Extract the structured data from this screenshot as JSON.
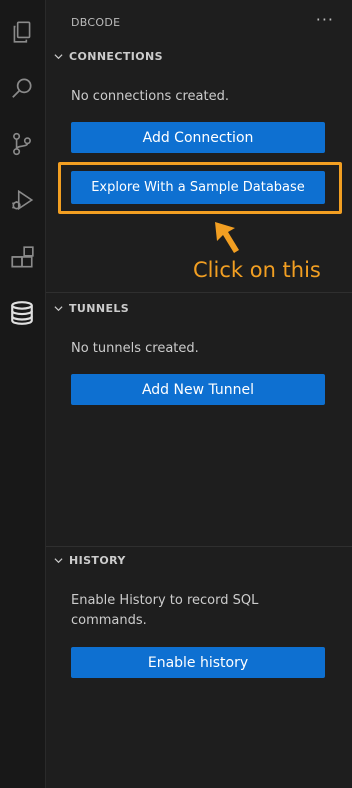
{
  "activity_bar": {
    "icons": [
      "explorer-icon",
      "search-icon",
      "source-control-icon",
      "run-debug-icon",
      "extensions-icon",
      "database-icon"
    ]
  },
  "sidebar": {
    "title": "DBCODE",
    "more_label": "···"
  },
  "connections": {
    "header": "CONNECTIONS",
    "empty_message": "No connections created.",
    "add_button": "Add Connection",
    "sample_button": "Explore With a Sample Database"
  },
  "annotation": {
    "text": "Click on this",
    "color": "#f29f22"
  },
  "tunnels": {
    "header": "TUNNELS",
    "empty_message": "No tunnels created.",
    "add_button": "Add New Tunnel"
  },
  "history": {
    "header": "HISTORY",
    "message": "Enable History to record SQL commands.",
    "enable_button": "Enable history"
  },
  "colors": {
    "button": "#0e70d1",
    "background": "#1e1e1e",
    "activity_bar": "#181818",
    "accent": "#f29f22"
  }
}
